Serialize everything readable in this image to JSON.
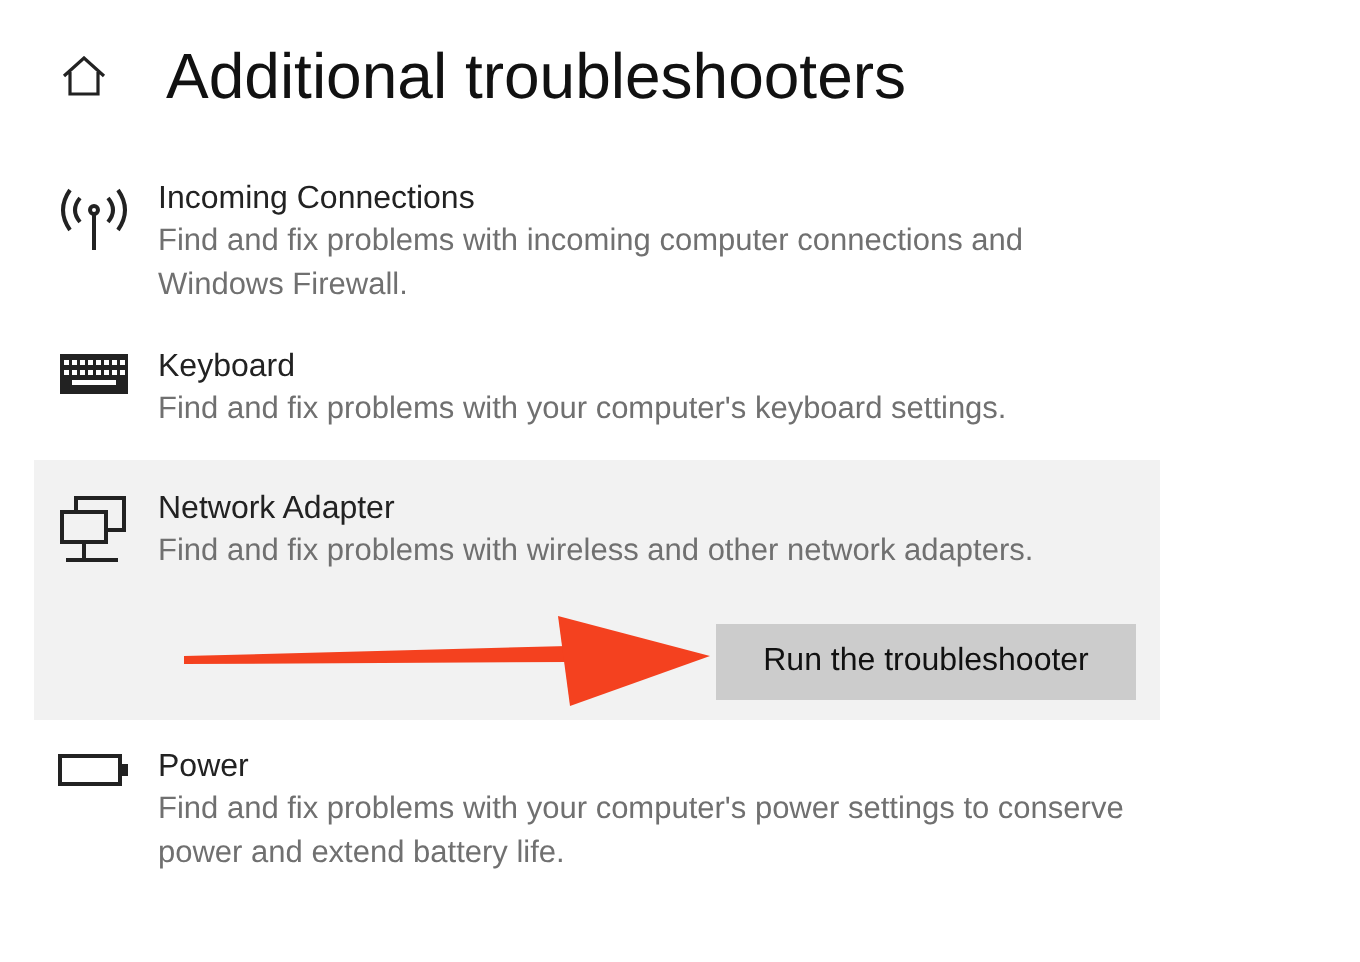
{
  "page": {
    "title": "Additional troubleshooters"
  },
  "items": [
    {
      "kind": "signal",
      "name": "Incoming Connections",
      "description": "Find and fix problems with incoming computer connections and Windows Firewall.",
      "selected": false
    },
    {
      "kind": "keyboard",
      "name": "Keyboard",
      "description": "Find and fix problems with your computer's keyboard settings.",
      "selected": false
    },
    {
      "kind": "network",
      "name": "Network Adapter",
      "description": "Find and fix problems with wireless and other network adapters.",
      "selected": true,
      "button": "Run the troubleshooter"
    },
    {
      "kind": "battery",
      "name": "Power",
      "description": "Find and fix problems with your computer's power settings to conserve power and extend battery life.",
      "selected": false
    }
  ]
}
